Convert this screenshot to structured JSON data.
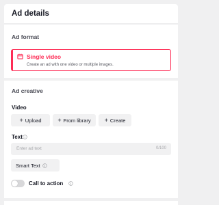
{
  "header": {
    "title": "Ad details"
  },
  "ad_format": {
    "section_title": "Ad format",
    "selected_option": {
      "icon": "calendar-icon",
      "title": "Single video",
      "description": "Create an ad with one video or multiple images."
    }
  },
  "ad_creative": {
    "section_title": "Ad creative",
    "video": {
      "label": "Video",
      "buttons": [
        {
          "icon": "plus-icon",
          "label": "Upload"
        },
        {
          "icon": "plus-icon",
          "label": "From library"
        },
        {
          "icon": "plus-icon",
          "label": "Create"
        }
      ]
    },
    "text": {
      "label": "Text",
      "info_icon": "info-icon",
      "placeholder": "Enter ad text",
      "counter": "0/100",
      "smart_text_label": "Smart Text",
      "smart_text_icon": "info-icon"
    },
    "call_to_action": {
      "label": "Call to action",
      "enabled": false,
      "info_icon": "info-icon"
    }
  },
  "colors": {
    "accent": "#fe2c55",
    "background": "#f0f0f1",
    "button_bg": "#f1f1f2",
    "toggle_off": "#d8d8da"
  }
}
